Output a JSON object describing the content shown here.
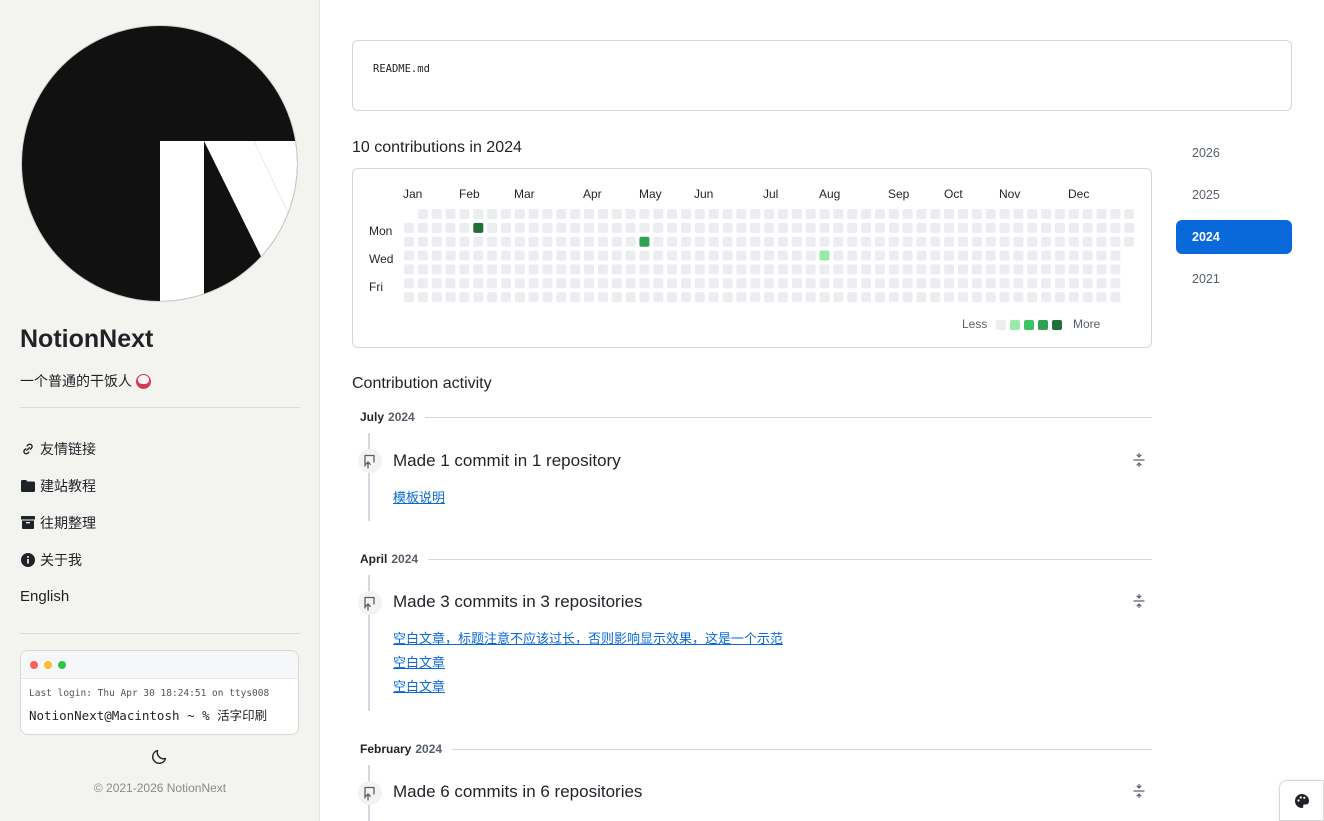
{
  "sidebar": {
    "site_name": "NotionNext",
    "description": "一个普通的干饭人",
    "menu": [
      {
        "label": "友情链接",
        "icon": "link-icon"
      },
      {
        "label": "建站教程",
        "icon": "folder-icon"
      },
      {
        "label": "往期整理",
        "icon": "archive-icon"
      },
      {
        "label": "关于我",
        "icon": "info-icon"
      },
      {
        "label": "English",
        "icon": ""
      }
    ],
    "terminal": {
      "login_line": "Last login: Thu Apr 30 18:24:51 on ttys008",
      "prompt_line": "NotionNext@Macintosh ~ % 活字印刷"
    },
    "copyright": "© 2021-2026 NotionNext"
  },
  "main": {
    "readme_label": "README.md",
    "contributions_title": "10 contributions in 2024",
    "calendar": {
      "months": [
        "Jan",
        "Feb",
        "Mar",
        "Apr",
        "May",
        "Jun",
        "Jul",
        "Aug",
        "Sep",
        "Oct",
        "Nov",
        "Dec"
      ],
      "day_labels": [
        "Mon",
        "Wed",
        "Fri"
      ],
      "legend_less": "Less",
      "legend_more": "More",
      "level_colors": [
        "#ebedf0",
        "#9be9a8",
        "#40c463",
        "#30a14e",
        "#216e39"
      ]
    },
    "years": [
      {
        "label": "2026",
        "active": false
      },
      {
        "label": "2025",
        "active": false
      },
      {
        "label": "2024",
        "active": true
      },
      {
        "label": "2021",
        "active": false
      }
    ],
    "activity_title": "Contribution activity",
    "sections": [
      {
        "month": "July",
        "year": "2024",
        "summary": "Made 1 commit in 1 repository",
        "repos": [
          "模板说明"
        ]
      },
      {
        "month": "April",
        "year": "2024",
        "summary": "Made 3 commits in 3 repositories",
        "repos": [
          "空白文章，标题注意不应该过长，否则影响显示效果，这是一个示范",
          "空白文章",
          "空白文章"
        ]
      },
      {
        "month": "February",
        "year": "2024",
        "summary": "Made 6 commits in 6 repositories",
        "repos": []
      }
    ]
  }
}
